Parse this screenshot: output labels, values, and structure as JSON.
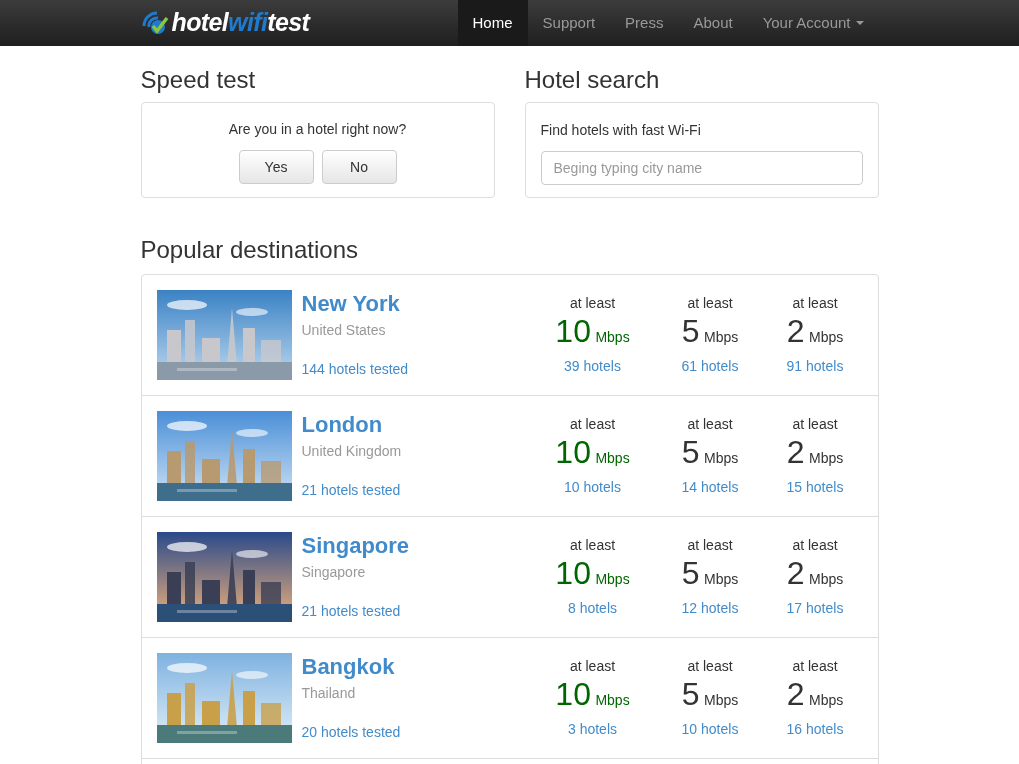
{
  "navbar": {
    "logo": [
      {
        "text": "hotel",
        "kind": "plain"
      },
      {
        "text": "wifi",
        "kind": "accent"
      },
      {
        "text": "test",
        "kind": "plain"
      }
    ],
    "items": [
      {
        "label": "Home",
        "selected": true
      },
      {
        "label": "Support",
        "selected": false
      },
      {
        "label": "Press",
        "selected": false
      },
      {
        "label": "About",
        "selected": false
      },
      {
        "label": "Your Account",
        "selected": false,
        "kind": "dropdown"
      }
    ]
  },
  "speed_test": {
    "title": "Speed test",
    "question": "Are you in a hotel right now?",
    "buttons": [
      "Yes",
      "No"
    ]
  },
  "hotel_search": {
    "title": "Hotel search",
    "label": "Find hotels with fast Wi-Fi",
    "placeholder": "Beging typing city name"
  },
  "popular": {
    "title": "Popular destinations",
    "destinations": [
      {
        "city": "New York",
        "country": "United States",
        "tested": "144 hotels tested",
        "photo": {
          "kind": "picture"
        },
        "tiers": [
          {
            "prefix": "at least",
            "speed": "10",
            "unit": "Mbps",
            "hotels": "39 hotels",
            "color": "#006600"
          },
          {
            "prefix": "at least",
            "speed": "5",
            "unit": "Mbps",
            "hotels": "61 hotels",
            "color": "#333333"
          },
          {
            "prefix": "at least",
            "speed": "2",
            "unit": "Mbps",
            "hotels": "91 hotels",
            "color": "#333333"
          }
        ]
      },
      {
        "city": "London",
        "country": "United Kingdom",
        "tested": "21 hotels tested",
        "photo": {
          "kind": "picture"
        },
        "tiers": [
          {
            "prefix": "at least",
            "speed": "10",
            "unit": "Mbps",
            "hotels": "10 hotels",
            "color": "#006600"
          },
          {
            "prefix": "at least",
            "speed": "5",
            "unit": "Mbps",
            "hotels": "14 hotels",
            "color": "#333333"
          },
          {
            "prefix": "at least",
            "speed": "2",
            "unit": "Mbps",
            "hotels": "15 hotels",
            "color": "#333333"
          }
        ]
      },
      {
        "city": "Singapore",
        "country": "Singapore",
        "tested": "21 hotels tested",
        "photo": {
          "kind": "picture"
        },
        "tiers": [
          {
            "prefix": "at least",
            "speed": "10",
            "unit": "Mbps",
            "hotels": "8 hotels",
            "color": "#006600"
          },
          {
            "prefix": "at least",
            "speed": "5",
            "unit": "Mbps",
            "hotels": "12 hotels",
            "color": "#333333"
          },
          {
            "prefix": "at least",
            "speed": "2",
            "unit": "Mbps",
            "hotels": "17 hotels",
            "color": "#333333"
          }
        ]
      },
      {
        "city": "Bangkok",
        "country": "Thailand",
        "tested": "20 hotels tested",
        "photo": {
          "kind": "picture"
        },
        "tiers": [
          {
            "prefix": "at least",
            "speed": "10",
            "unit": "Mbps",
            "hotels": "3 hotels",
            "color": "#006600"
          },
          {
            "prefix": "at least",
            "speed": "5",
            "unit": "Mbps",
            "hotels": "10 hotels",
            "color": "#333333"
          },
          {
            "prefix": "at least",
            "speed": "2",
            "unit": "Mbps",
            "hotels": "16 hotels",
            "color": "#333333"
          }
        ]
      }
    ]
  }
}
